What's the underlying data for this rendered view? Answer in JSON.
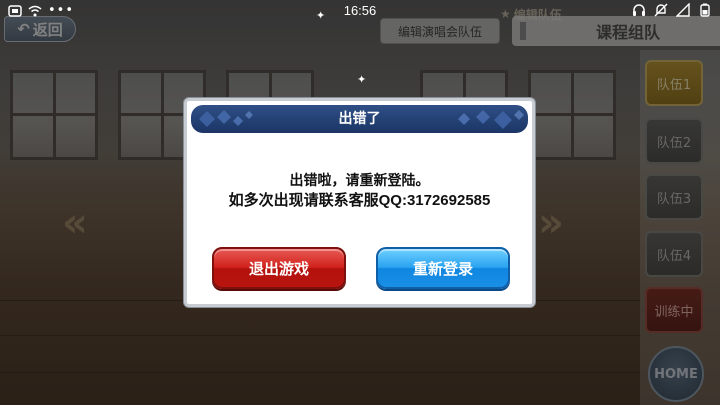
{
  "status_bar": {
    "time": "16:56"
  },
  "top_bar": {
    "back_label": "返回",
    "edit_tab_label": "编辑演唱会队伍",
    "edit_team_label": "编辑队伍",
    "course_header": "课程组队"
  },
  "side_panel": {
    "teams": [
      "队伍1",
      "队伍2",
      "队伍3",
      "队伍4"
    ],
    "training_label": "训练中",
    "home_label": "HOME"
  },
  "dialog": {
    "title": "出错了",
    "message_line1": "出错啦，请重新登陆。",
    "message_line2": "如多次出现请联系客服QQ:3172692585",
    "quit_button": "退出游戏",
    "relogin_button": "重新登录"
  },
  "colors": {
    "dialog_header": "#1b3566",
    "quit_button": "#d1221c",
    "relogin_button": "#2aa3f0",
    "active_team": "#b38f2a"
  }
}
